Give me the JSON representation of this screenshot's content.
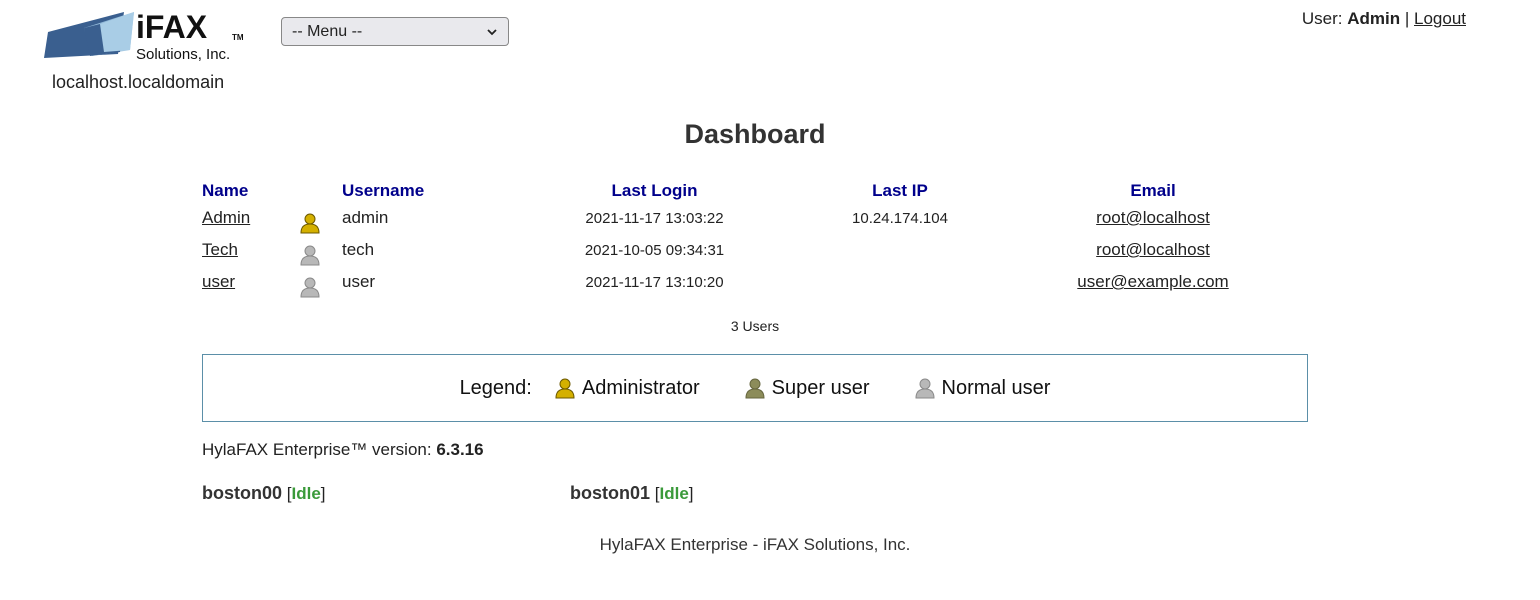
{
  "header": {
    "logo_text": "iFAX",
    "logo_subtext": "Solutions, Inc.",
    "logo_tm": "TM",
    "hostname": "localhost.localdomain",
    "menu_selected": "-- Menu --",
    "user_label": "User:",
    "user_name": "Admin",
    "separator": "|",
    "logout_label": "Logout"
  },
  "page_title": "Dashboard",
  "users_table": {
    "columns": [
      "Name",
      "Username",
      "Last Login",
      "Last IP",
      "Email"
    ],
    "rows": [
      {
        "name": "Admin",
        "role_icon": "administrator-user-icon",
        "username": "admin",
        "last_login": "2021-11-17 13:03:22",
        "last_ip": "10.24.174.104",
        "email": "root@localhost"
      },
      {
        "name": "Tech",
        "role_icon": "normal-user-icon",
        "username": "tech",
        "last_login": "2021-10-05 09:34:31",
        "last_ip": "",
        "email": "root@localhost"
      },
      {
        "name": "user",
        "role_icon": "normal-user-icon",
        "username": "user",
        "last_login": "2021-11-17 13:10:20",
        "last_ip": "",
        "email": "user@example.com"
      }
    ],
    "count_text": "3 Users"
  },
  "legend": {
    "label": "Legend:",
    "items": [
      {
        "icon": "administrator-user-icon",
        "label": "Administrator"
      },
      {
        "icon": "super-user-icon",
        "label": "Super user"
      },
      {
        "icon": "normal-user-icon",
        "label": "Normal user"
      }
    ]
  },
  "version": {
    "label": "HylaFAX Enterprise™ version:",
    "value": "6.3.16"
  },
  "modems": [
    {
      "name": "boston00",
      "bracket_open": "[",
      "status": "Idle",
      "bracket_close": "]"
    },
    {
      "name": "boston01",
      "bracket_open": "[",
      "status": "Idle",
      "bracket_close": "]"
    }
  ],
  "footer": "HylaFAX Enterprise - iFAX Solutions, Inc.",
  "colors": {
    "header_link": "#00008b",
    "admin_icon": "#d4b000",
    "super_icon": "#8c8c5a",
    "normal_icon": "#b8b8b8",
    "status_idle": "#3a9a3a",
    "legend_border": "#5b8fa8",
    "logo_blue": "#3a5f8f"
  }
}
